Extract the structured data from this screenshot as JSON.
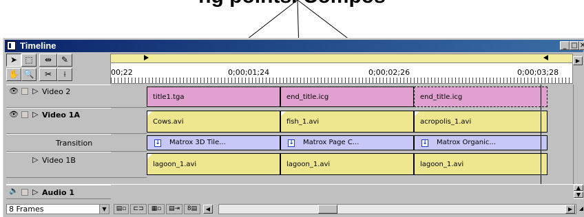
{
  "callout": {
    "text": "ng points. Compos"
  },
  "window": {
    "title": "Timeline",
    "min_label": "_",
    "max_label": "□",
    "close_label": "✕"
  },
  "tools": [
    {
      "name": "selection-tool",
      "glyph": "➤"
    },
    {
      "name": "range-select-tool",
      "glyph": "⬚"
    },
    {
      "name": "multitrack-select-tool",
      "glyph": "⇹"
    },
    {
      "name": "pen-tool",
      "glyph": "✎"
    },
    {
      "name": "hand-tool",
      "glyph": "✋"
    },
    {
      "name": "zoom-tool",
      "glyph": "🔍"
    },
    {
      "name": "razor-tool",
      "glyph": "✂"
    },
    {
      "name": "in-out-tool",
      "glyph": "⟊"
    }
  ],
  "ruler": {
    "labels": [
      "00;22",
      "0;00;01;24",
      "0;00;02;26",
      "0;00;03;28"
    ]
  },
  "tracks": [
    {
      "name": "Video 2",
      "bold": false,
      "eye": true
    },
    {
      "name": "Video 1A",
      "bold": true,
      "eye": true
    },
    {
      "name": "Transition",
      "bold": false,
      "eye": false
    },
    {
      "name": "Video 1B",
      "bold": false,
      "eye": false
    }
  ],
  "clips": {
    "video2": [
      "title1.tga",
      "end_title.icg",
      "end_title.icg"
    ],
    "video1a": [
      "Cows.avi",
      "fish_1.avi",
      "acropolis_1.avi"
    ],
    "transition": [
      "Matrox 3D Tile...",
      "Matrox Page C...",
      "Matrox Organic..."
    ],
    "video1b": [
      "lagoon_1.avi",
      "lagoon_1.avi",
      "lagoon_1.avi"
    ]
  },
  "audio": {
    "name": "Audio 1"
  },
  "bottom": {
    "frames_value": "8 Frames"
  },
  "colors": {
    "title_pink": "#e0a0d0",
    "video_yellow": "#efe78f",
    "transition_blue": "#c8c8f8",
    "titlebar": "#0a246a"
  }
}
